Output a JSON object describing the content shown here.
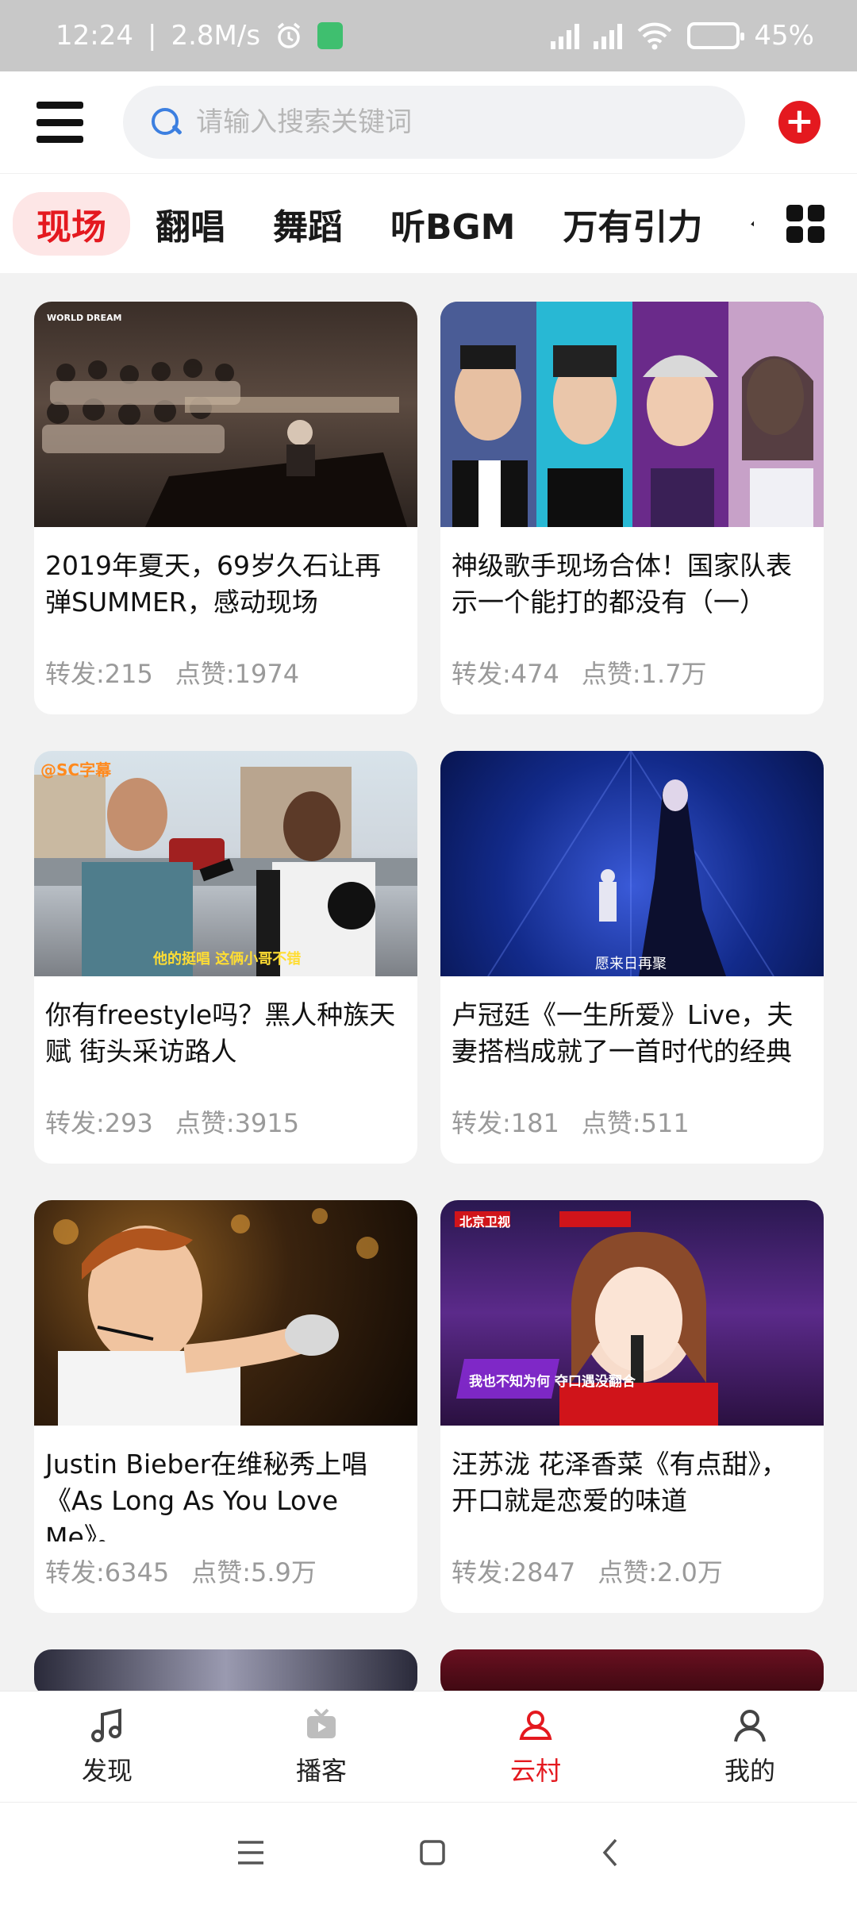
{
  "status_bar": {
    "time": "12:24",
    "speed": "2.8M/s",
    "battery": "45%",
    "battery_level": 0.45
  },
  "header": {
    "search_placeholder": "请输入搜索关键词"
  },
  "tabs": [
    {
      "label": "现场",
      "active": true
    },
    {
      "label": "翻唱"
    },
    {
      "label": "舞蹈"
    },
    {
      "label": "听BGM"
    },
    {
      "label": "万有引力"
    },
    {
      "label": "乍"
    }
  ],
  "cards": [
    {
      "title": "2019年夏天，69岁久石让再弹SUMMER，感动现场",
      "shares": "转发:215",
      "likes": "点赞:1974"
    },
    {
      "title": "神级歌手现场合体！国家队表示一个能打的都没有（一）",
      "shares": "转发:474",
      "likes": "点赞:1.7万"
    },
    {
      "title": "你有freestyle吗？黑人种族天赋 街头采访路人",
      "shares": "转发:293",
      "likes": "点赞:3915",
      "overlay": "@SC字幕",
      "caption": "他的挺唱 这俩小哥不错"
    },
    {
      "title": "卢冠廷《一生所爱》Live，夫妻搭档成就了一首时代的经典",
      "shares": "转发:181",
      "likes": "点赞:511",
      "caption": "愿来日再聚"
    },
    {
      "title": "Justin Bieber在维秘秀上唱《As Long As You Love Me》。",
      "shares": "转发:6345",
      "likes": "点赞:5.9万"
    },
    {
      "title": "汪苏泷 花泽香菜《有点甜》，开口就是恋爱的味道",
      "shares": "转发:2847",
      "likes": "点赞:2.0万",
      "overlay": "北京卫视",
      "caption": "我也不知为何 夺口遇没翻合"
    }
  ],
  "bottom_nav": [
    {
      "label": "发现",
      "icon": "music-note-icon"
    },
    {
      "label": "播客",
      "icon": "podcast-icon"
    },
    {
      "label": "云村",
      "icon": "community-icon",
      "active": true
    },
    {
      "label": "我的",
      "icon": "profile-icon"
    }
  ],
  "colors": {
    "accent": "#e4191f",
    "search_icon": "#3c7fe0"
  }
}
